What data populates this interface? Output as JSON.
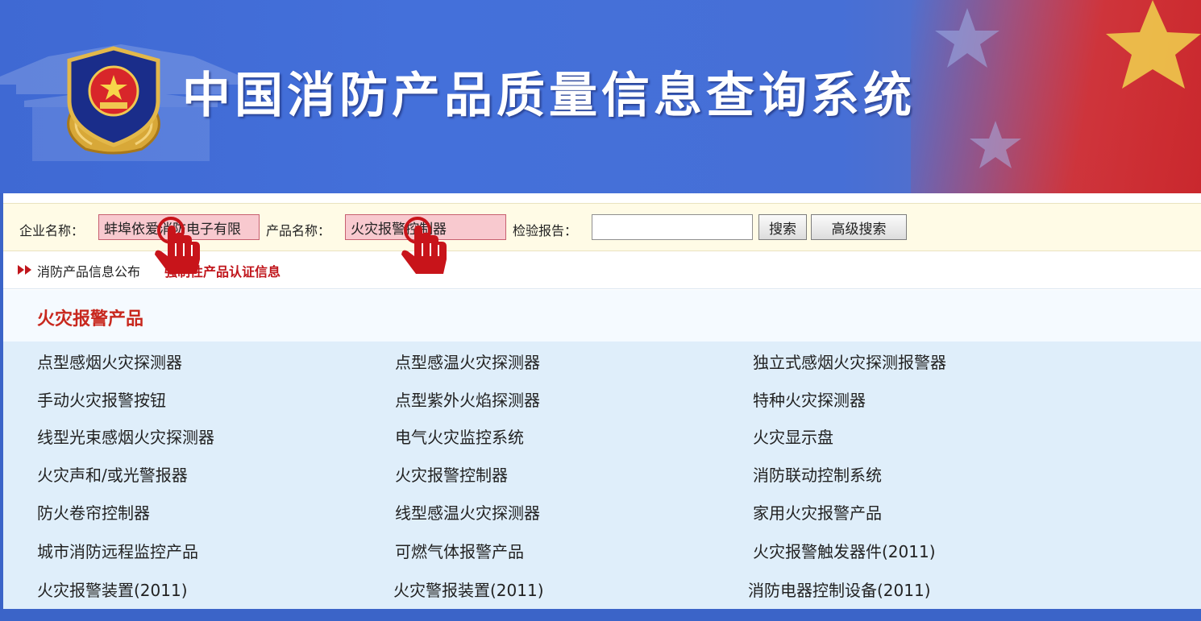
{
  "header": {
    "title": "中国消防产品质量信息查询系统"
  },
  "colors": {
    "header_blue": "#4470da",
    "accent_red": "#c8281e",
    "search_bg": "#fffbe6",
    "list_bg": "#dfeefa"
  },
  "search": {
    "company_label": "企业名称：",
    "company_value": "蚌埠依爱消防电子有限",
    "product_label": "产品名称：",
    "product_value": "火灾报警控制器",
    "report_label": "检验报告：",
    "report_value": "",
    "search_button": "搜索",
    "advanced_button": "高级搜索"
  },
  "breadcrumb": {
    "item1": "消防产品信息公布",
    "item2": "强制性产品认证信息"
  },
  "category": {
    "title": "火灾报警产品",
    "items": [
      "点型感烟火灾探测器",
      "点型感温火灾探测器",
      "独立式感烟火灾探测报警器",
      "手动火灾报警按钮",
      "点型紫外火焰探测器",
      "特种火灾探测器",
      "线型光束感烟火灾探测器",
      "电气火灾监控系统",
      "火灾显示盘",
      "火灾声和/或光警报器",
      "火灾报警控制器",
      "消防联动控制系统",
      "防火卷帘控制器",
      "线型感温火灾探测器",
      "家用火灾报警产品",
      "城市消防远程监控产品",
      "可燃气体报警产品",
      "火灾报警触发器件(2011)",
      "火灾报警装置(2011)",
      "火灾警报装置(2011)",
      "消防电器控制设备(2011)"
    ]
  }
}
